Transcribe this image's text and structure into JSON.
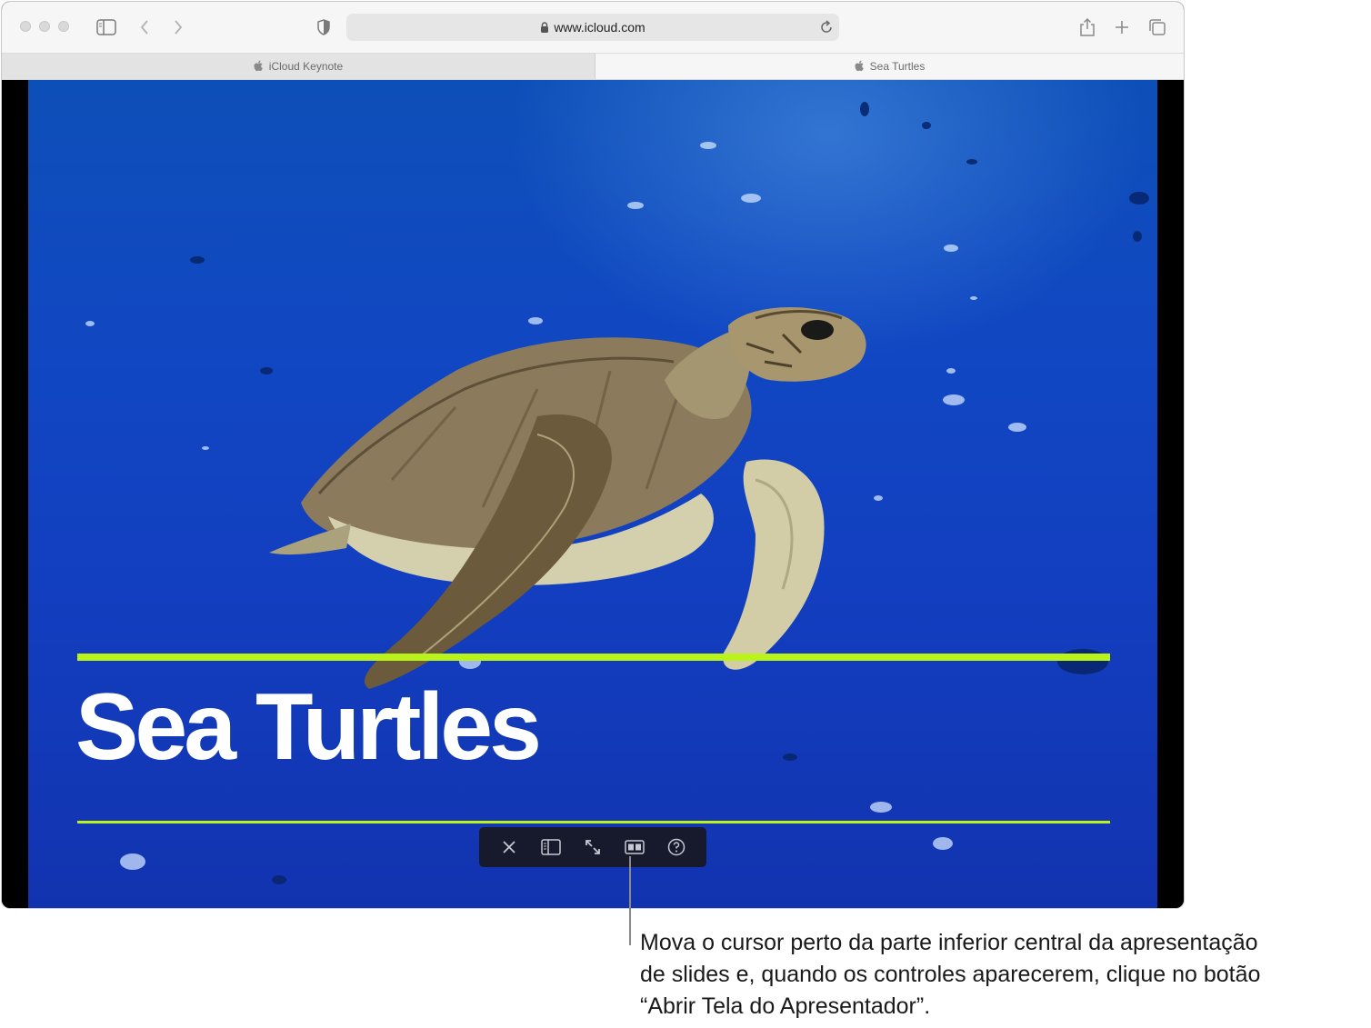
{
  "browser": {
    "url": "www.icloud.com",
    "tabs": [
      {
        "label": "iCloud Keynote",
        "active": false
      },
      {
        "label": "Sea Turtles",
        "active": true
      }
    ]
  },
  "slide": {
    "title": "Sea Turtles",
    "accent_color": "#b9f31a"
  },
  "controls": [
    {
      "icon": "close-icon"
    },
    {
      "icon": "sidebar-icon"
    },
    {
      "icon": "exit-fullscreen-icon"
    },
    {
      "icon": "presenter-display-icon"
    },
    {
      "icon": "help-icon"
    }
  ],
  "caption": {
    "line1": "Mova o cursor perto da parte inferior central da apresentação",
    "line2": "de slides e, quando os controles aparecerem, clique no botão",
    "line3": "“Abrir Tela do Apresentador”."
  }
}
